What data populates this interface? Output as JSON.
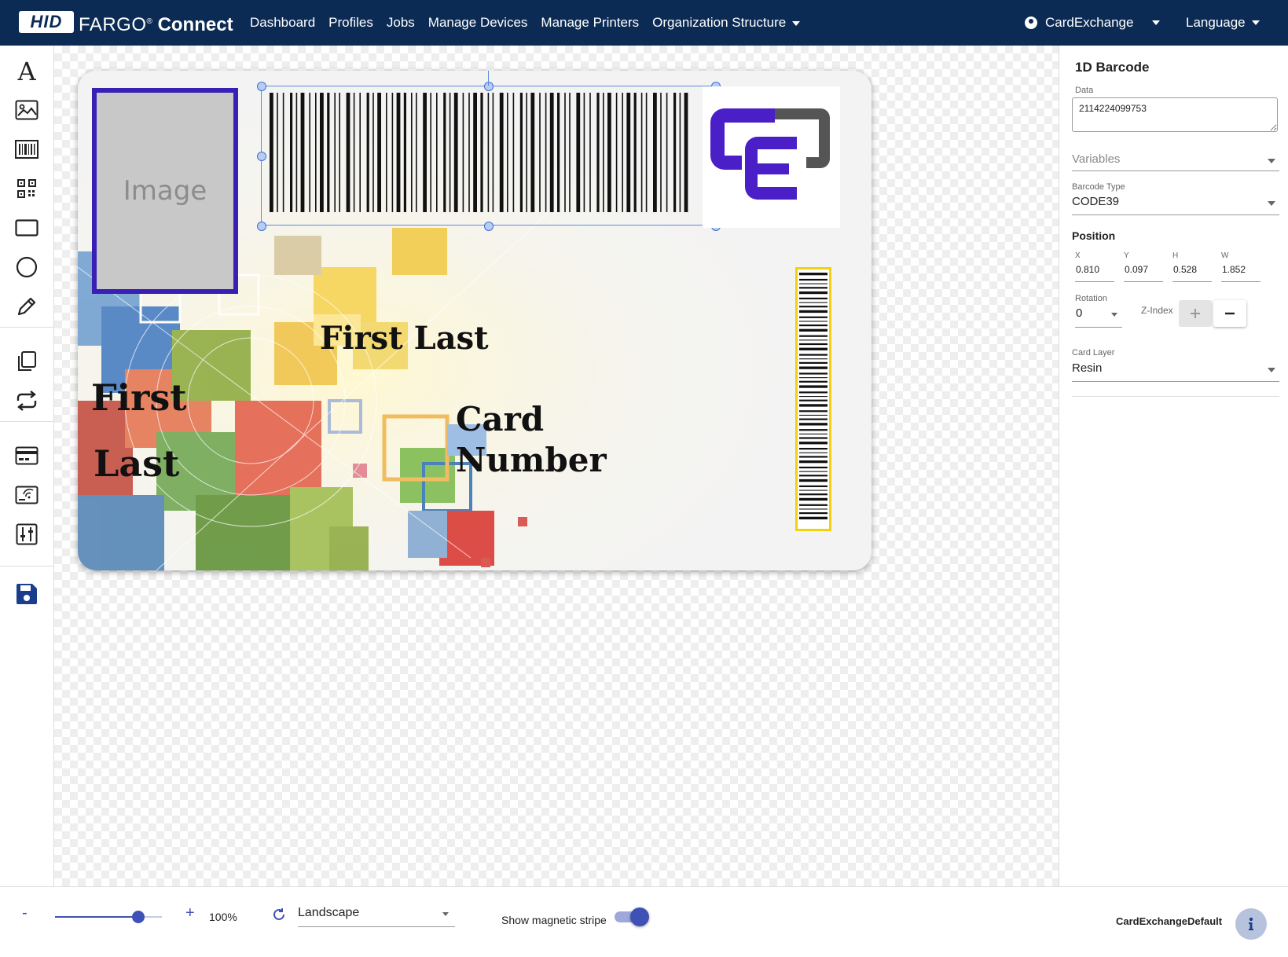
{
  "nav": {
    "logo": "HID",
    "brand_light": "FARGO",
    "brand_reg": "®",
    "brand_bold": "Connect",
    "menu": [
      "Dashboard",
      "Profiles",
      "Jobs",
      "Manage Devices",
      "Manage Printers",
      "Organization Structure"
    ],
    "user": "CardExchange",
    "language": "Language"
  },
  "toolbar": {
    "tools": [
      "text-tool",
      "image-tool",
      "barcode-tool",
      "qrcode-tool",
      "rectangle-tool",
      "ellipse-tool",
      "pen-tool",
      "duplicate-tool",
      "swap-tool",
      "magstripe-tool",
      "encoding-tool",
      "settings-tool",
      "save-tool"
    ]
  },
  "card": {
    "photo_placeholder": "Image",
    "name_center": "First Last",
    "name_first": "First",
    "name_last": "Last",
    "card_number_1": "Card",
    "card_number_2": "Number",
    "colors": {
      "photo_border": "#3a1fb5",
      "vbarcode_border": "#f1d20c",
      "logo_purple": "#4b1fc8",
      "logo_gray": "#555555"
    }
  },
  "panel": {
    "title": "1D Barcode",
    "data_label": "Data",
    "data_value": "2114224099753",
    "variables_placeholder": "Variables",
    "barcode_type_label": "Barcode Type",
    "barcode_type_value": "CODE39",
    "position_title": "Position",
    "pos": {
      "x_label": "X",
      "x_value": "0.810",
      "y_label": "Y",
      "y_value": "0.097",
      "h_label": "H",
      "h_value": "0.528",
      "w_label": "W",
      "w_value": "1.852"
    },
    "rotation_label": "Rotation",
    "rotation_value": "0",
    "zindex_label": "Z-Index",
    "card_layer_label": "Card Layer",
    "card_layer_value": "Resin"
  },
  "bottom": {
    "zoom_minus": "-",
    "zoom_plus": "+",
    "zoom_value": "100%",
    "zoom_fraction": 0.78,
    "orientation": "Landscape",
    "magstripe_label": "Show magnetic stripe",
    "magstripe_on": true,
    "template_name": "CardExchangeDefault",
    "accent": "#3f51b5"
  }
}
